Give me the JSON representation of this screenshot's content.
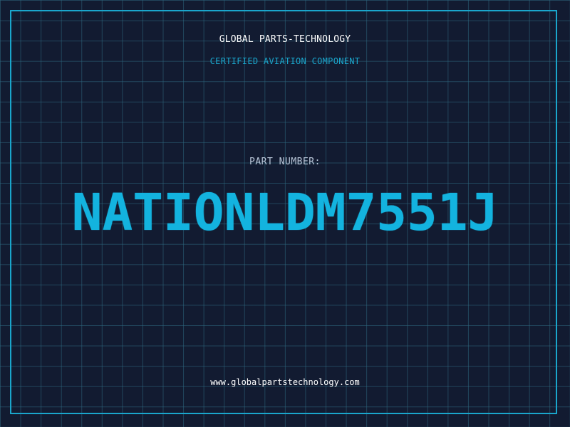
{
  "header": {
    "company": "GLOBAL PARTS-TECHNOLOGY",
    "subtitle": "CERTIFIED AVIATION COMPONENT"
  },
  "part": {
    "label": "PART NUMBER:",
    "number": "NATIONLDM7551J"
  },
  "footer": {
    "website": "www.globalpartstechnology.com"
  },
  "colors": {
    "background": "#121b31",
    "grid": "#2e6980",
    "accent": "#13b3df",
    "border": "#1aa6cc",
    "label": "#b8c6d8",
    "text": "#ffffff"
  }
}
